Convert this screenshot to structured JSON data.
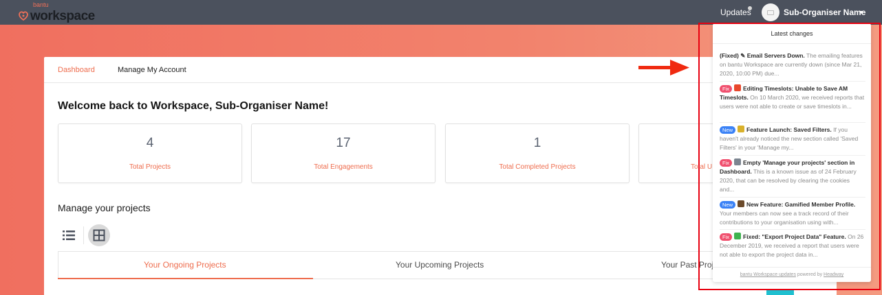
{
  "nav": {
    "logo_small": "bantu",
    "logo_big": "workspace",
    "updates_label": "Updates",
    "user_name": "Sub-Organiser Name"
  },
  "page_tabs": [
    "Dashboard",
    "Manage My Account"
  ],
  "welcome": "Welcome back to Workspace, Sub-Organiser Name!",
  "stats": [
    {
      "value": "4",
      "label": "Total Projects"
    },
    {
      "value": "17",
      "label": "Total Engagements"
    },
    {
      "value": "1",
      "label": "Total Completed Projects"
    },
    {
      "value": "",
      "label": "Total U"
    }
  ],
  "manage_title": "Manage your projects",
  "project_tabs": [
    "Your Ongoing Projects",
    "Your Upcoming Projects",
    "Your Past Proj"
  ],
  "updates_panel": {
    "title": "Latest changes",
    "items": [
      {
        "badge": "",
        "title": "(Fixed) ✎ Email Servers Down.",
        "body": " The emailing features on bantu Workspace are currently down (since Mar 21, 2020, 10:00 PM) due..."
      },
      {
        "badge": "Fix",
        "title": "Editing Timeslots: Unable to Save AM Timeslots.",
        "body": " On 10 March 2020, we received reports that users were not able to create or save timeslots in..."
      },
      {
        "badge": "New",
        "title": "Feature Launch: Saved Filters.",
        "body": " If you haven't already noticed the new section called 'Saved Filters' in your 'Manage my..."
      },
      {
        "badge": "Fix",
        "title": "Empty 'Manage your projects' section in Dashboard.",
        "body": " This is a known issue as of 24 February 2020, that can be resolved by clearing the cookies and..."
      },
      {
        "badge": "New",
        "title": "New Feature: Gamified Member Profile.",
        "body": " Your members can now see a track record of their contributions to your organisation using with..."
      },
      {
        "badge": "Fix",
        "title": "Fixed: \"Export Project Data\" Feature.",
        "body": " On 26 December 2019, we received a report that users were not able to export the project data in..."
      }
    ],
    "footer_link": "bantu Workspace updates",
    "footer_mid": " powered by ",
    "footer_brand": "Headway"
  },
  "colors": {
    "accent": "#ee6c4d",
    "topbar": "#4b515d",
    "fix_badge": "#f0506e",
    "new_badge": "#3b82f6",
    "highlight_frame": "#e8000f"
  },
  "icons": {
    "list_view": "list-view-icon",
    "grid_view": "grid-view-icon",
    "annotation_arrow": "arrow-right-icon"
  }
}
